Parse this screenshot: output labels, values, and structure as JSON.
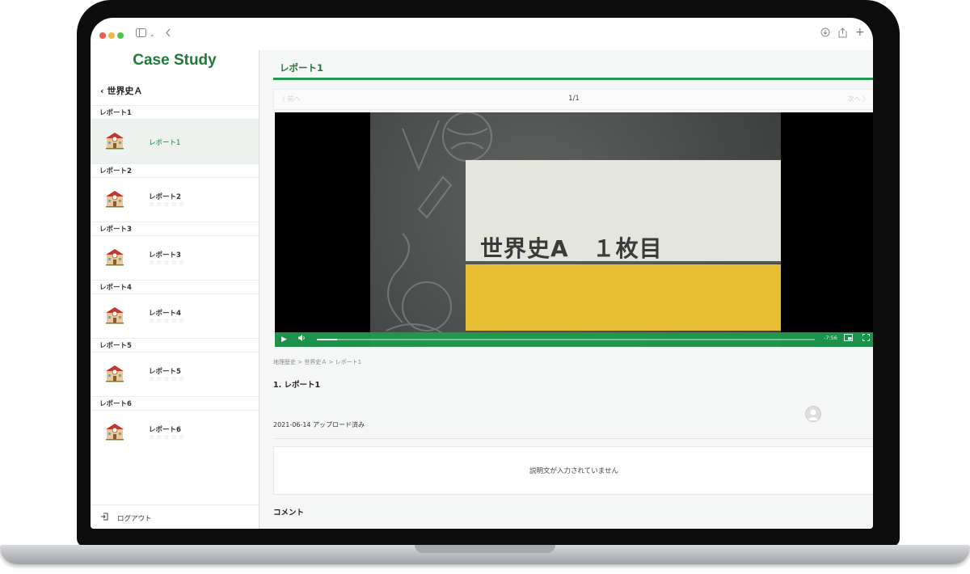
{
  "app": {
    "logo": "Case Study",
    "brand_color": "#1f7a3a",
    "accent_color": "#1f9a4f"
  },
  "chrome": {
    "sidebar_toggle_icon": "sidebar-icon",
    "back_icon": "chevron-left-icon",
    "download_icon": "download-icon",
    "share_icon": "share-icon",
    "new_tab_icon": "plus-icon"
  },
  "sidebar": {
    "back_label": "世界史Ａ",
    "sections": [
      {
        "header": "レポート1",
        "item_label": "レポート1",
        "active": true,
        "stars": ""
      },
      {
        "header": "レポート2",
        "item_label": "レポート2",
        "active": false,
        "stars": "☆☆☆☆☆"
      },
      {
        "header": "レポート3",
        "item_label": "レポート3",
        "active": false,
        "stars": "☆☆☆☆☆"
      },
      {
        "header": "レポート4",
        "item_label": "レポート4",
        "active": false,
        "stars": "☆☆☆☆☆"
      },
      {
        "header": "レポート5",
        "item_label": "レポート5",
        "active": false,
        "stars": "☆☆☆☆☆"
      },
      {
        "header": "レポート6",
        "item_label": "レポート6",
        "active": false,
        "stars": "☆☆☆☆☆"
      }
    ],
    "logout_label": "ログアウト"
  },
  "main": {
    "title": "レポート1",
    "pager": {
      "prev_label": "〈 前へ",
      "count": "1/1",
      "next_label": "次へ 〉"
    },
    "video": {
      "slide_title": "世界史A　１枚目",
      "time_remaining": "-7:56",
      "progress": 0.04
    },
    "breadcrumb": "地理歴史  >  世界史Ａ  >  レポート1",
    "item_heading": "1. レポート1",
    "upload_date": "2021-06-14 アップロード済み",
    "description": "説明文が入力されていません",
    "comment_heading": "コメント"
  }
}
